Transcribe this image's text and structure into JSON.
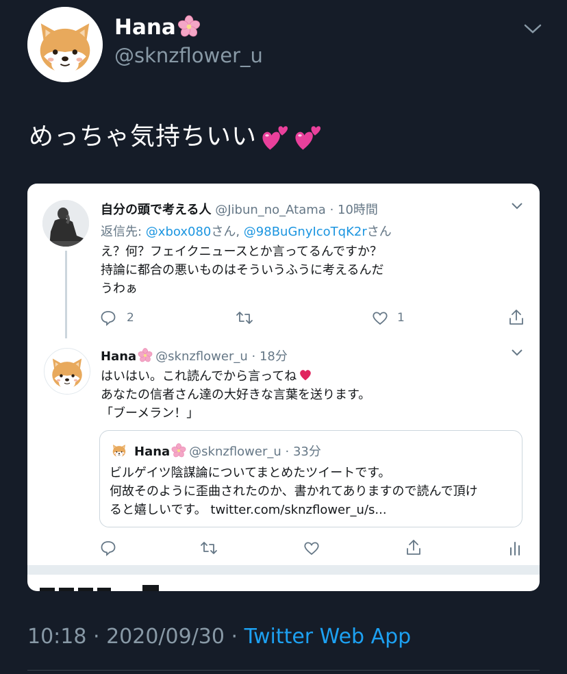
{
  "main_tweet": {
    "display_name": "Hana",
    "handle": "@sknzflower_u",
    "text": "めっちゃ気持ちいい",
    "timestamp": "10:18 · 2020/09/30 ·",
    "source_app": "Twitter Web App"
  },
  "screenshot": {
    "parent_tweet": {
      "author": "自分の頭で考える人",
      "handle": "@Jibun_no_Atama",
      "time": "· 10時間",
      "reply_prefix": "返信先: ",
      "reply_to_1": "@xbox080",
      "reply_san_1": "さん, ",
      "reply_to_2": "@98BuGnyIcoTqK2r",
      "reply_san_2": "さん",
      "lines": [
        "え？何？フェイクニュースとか言ってるんですか？",
        "持論に都合の悪いものはそういうふうに考えるんだ",
        "うわぁ"
      ],
      "reply_count": "2",
      "like_count": "1"
    },
    "reply_tweet": {
      "author": "Hana",
      "handle": "@sknzflower_u",
      "time": "· 18分",
      "lines": [
        "はいはい。これ読んでから言ってね",
        "あなたの信者さん達の大好きな言葉を送ります。",
        "「ブーメラン！」"
      ]
    },
    "quoted_tweet": {
      "author": "Hana",
      "handle": "@sknzflower_u",
      "time": "· 33分",
      "lines": [
        "ビルゲイツ陰謀論についてまとめたツイートです。",
        "何故そのように歪曲されたのか、書かれてありますので読んで頂け",
        "ると嬉しいです。 twitter.com/sknzflower_u/s..."
      ]
    }
  },
  "icons": [
    "shiba-avatar",
    "cherry-blossom-icon",
    "two-hearts-emoji",
    "chevron-down-icon",
    "reply-icon",
    "retweet-icon",
    "like-icon",
    "share-icon",
    "analytics-icon",
    "heart-emoji"
  ],
  "colors": {
    "background": "#151c28",
    "link": "#1da1f2",
    "muted": "#8899a6",
    "heart": "#e0245e",
    "blossom": "#f4a6c6"
  }
}
